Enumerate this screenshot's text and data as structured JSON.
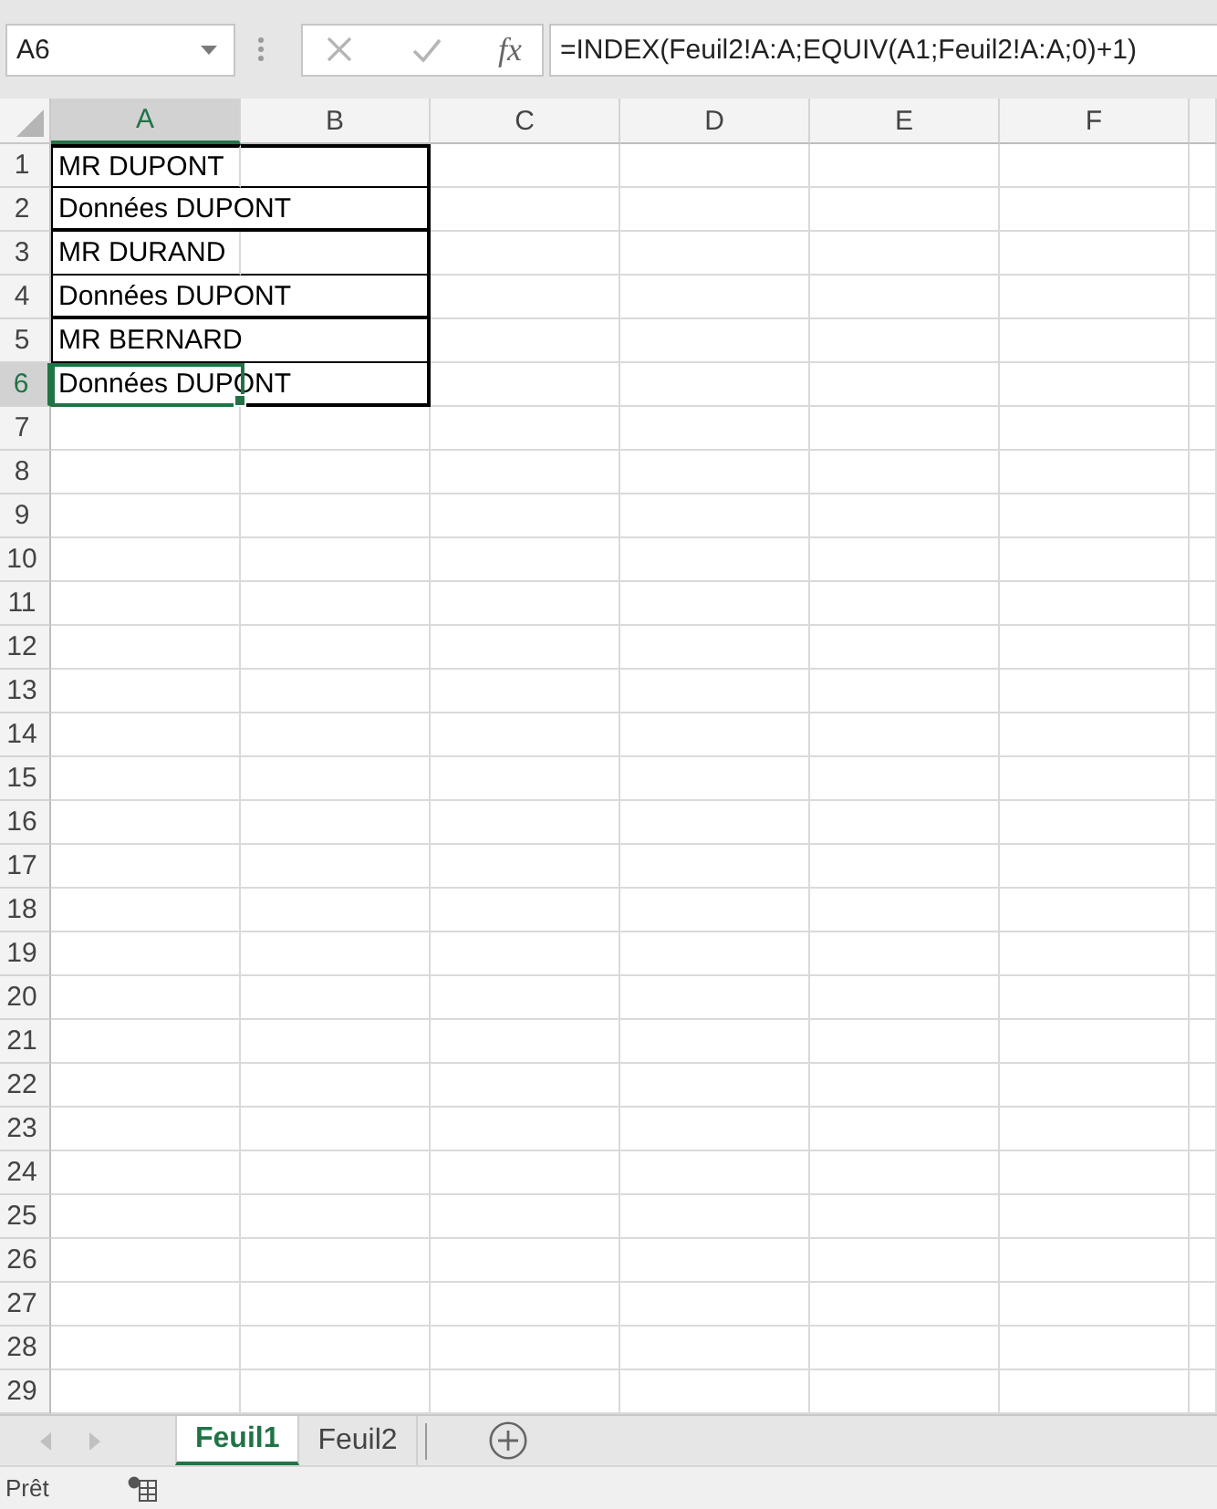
{
  "name_box": {
    "value": "A6"
  },
  "formula_bar": {
    "function_label": "fx",
    "formula": "=INDEX(Feuil2!A:A;EQUIV(A1;Feuil2!A:A;0)+1)"
  },
  "columns": [
    {
      "label": "A",
      "selected": true
    },
    {
      "label": "B",
      "selected": false
    },
    {
      "label": "C",
      "selected": false
    },
    {
      "label": "D",
      "selected": false
    },
    {
      "label": "E",
      "selected": false
    },
    {
      "label": "F",
      "selected": false
    }
  ],
  "rows": [
    {
      "label": "1",
      "selected": false,
      "cells": [
        {
          "text": "MR DUPONT",
          "overflows": false,
          "bordered": true,
          "thick_bottom": false
        },
        {
          "bordered": true,
          "thick_bottom": false
        }
      ]
    },
    {
      "label": "2",
      "selected": false,
      "cells": [
        {
          "text": "Données DUPONT",
          "overflows": true,
          "bordered": true,
          "thick_bottom": true
        },
        {
          "bordered": true,
          "thick_bottom": true
        }
      ]
    },
    {
      "label": "3",
      "selected": false,
      "cells": [
        {
          "text": "MR DURAND",
          "overflows": false,
          "bordered": true,
          "thick_bottom": false
        },
        {
          "bordered": true,
          "thick_bottom": false
        }
      ]
    },
    {
      "label": "4",
      "selected": false,
      "cells": [
        {
          "text": "Données DUPONT",
          "overflows": true,
          "bordered": true,
          "thick_bottom": true
        },
        {
          "bordered": true,
          "thick_bottom": true
        }
      ]
    },
    {
      "label": "5",
      "selected": false,
      "cells": [
        {
          "text": "MR BERNARD",
          "overflows": true,
          "bordered": true,
          "thick_bottom": false
        },
        {
          "bordered": true,
          "thick_bottom": false
        }
      ]
    },
    {
      "label": "6",
      "selected": true,
      "cells": [
        {
          "text": "Données DUPONT",
          "overflows": true,
          "bordered": true,
          "thick_bottom": true
        },
        {
          "bordered": true,
          "thick_bottom": true
        }
      ]
    },
    {
      "label": "7",
      "selected": false
    },
    {
      "label": "8",
      "selected": false
    },
    {
      "label": "9",
      "selected": false
    },
    {
      "label": "10",
      "selected": false
    },
    {
      "label": "11",
      "selected": false
    },
    {
      "label": "12",
      "selected": false
    },
    {
      "label": "13",
      "selected": false
    },
    {
      "label": "14",
      "selected": false
    },
    {
      "label": "15",
      "selected": false
    },
    {
      "label": "16",
      "selected": false
    },
    {
      "label": "17",
      "selected": false
    },
    {
      "label": "18",
      "selected": false
    },
    {
      "label": "19",
      "selected": false
    },
    {
      "label": "20",
      "selected": false
    },
    {
      "label": "21",
      "selected": false
    },
    {
      "label": "22",
      "selected": false
    },
    {
      "label": "23",
      "selected": false
    },
    {
      "label": "24",
      "selected": false
    },
    {
      "label": "25",
      "selected": false
    },
    {
      "label": "26",
      "selected": false
    },
    {
      "label": "27",
      "selected": false
    },
    {
      "label": "28",
      "selected": false
    },
    {
      "label": "29",
      "selected": false
    }
  ],
  "sheet_tabs": [
    {
      "label": "Feuil1",
      "selected": true
    },
    {
      "label": "Feuil2",
      "selected": false
    }
  ],
  "status_bar": {
    "text": "Prêt"
  }
}
